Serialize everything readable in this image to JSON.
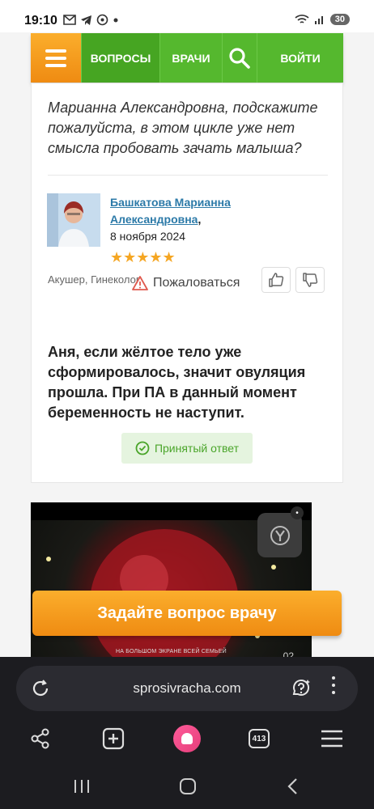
{
  "status_bar": {
    "time": "19:10",
    "battery": "30"
  },
  "nav": {
    "questions": "ВОПРОСЫ",
    "doctors": "ВРАЧИ",
    "login": "ВОЙТИ"
  },
  "question": {
    "text": "Марианна Александровна, подскажите пожалуйста, в этом цикле уже нет смысла пробовать зачать малыша?"
  },
  "doctor": {
    "name": "Башкатова Марианна Александровна",
    "comma": ",",
    "date": "8 ноября 2024",
    "specialty": "Акушер, Гинеколог",
    "rating": "★★★★★"
  },
  "actions": {
    "complain": "Пожаловаться"
  },
  "answer": {
    "text": "Аня, если жёлтое тело уже сформировалось, значит овуляция прошла. При ПА в данный момент беременность не наступит.",
    "accepted_label": "Принятый ответ"
  },
  "video": {
    "caption": "НА БОЛЬШОМ ЭКРАНЕ ВСЕЙ СЕМЬЕЙ",
    "counter": "02"
  },
  "cta": {
    "ask_doctor": "Задайте вопрос врачу"
  },
  "browser": {
    "url": "sprosivracha.com",
    "tabs_count": "413"
  },
  "colors": {
    "green": "#55b82e",
    "orange": "#f39c1e",
    "link": "#2c7aa8",
    "star": "#f5a623"
  }
}
